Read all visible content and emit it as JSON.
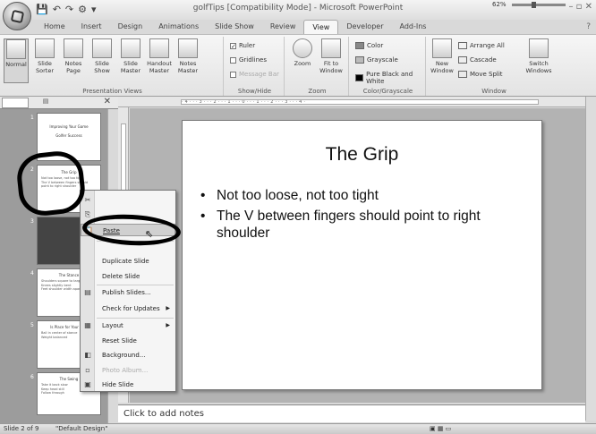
{
  "window": {
    "title": "golfTips [Compatibility Mode] - Microsoft PowerPoint",
    "controls": "– ▫ ✕"
  },
  "qat": [
    "💾",
    "↶",
    "↷",
    "⚙",
    "▾"
  ],
  "tabs": [
    "Home",
    "Insert",
    "Design",
    "Animations",
    "Slide Show",
    "Review",
    "View",
    "Developer",
    "Add-Ins"
  ],
  "active_tab": "View",
  "ribbon": {
    "presentation_views": {
      "label": "Presentation Views",
      "buttons": [
        "Normal",
        "Slide Sorter",
        "Notes Page",
        "Slide Show",
        "Slide Master",
        "Handout Master",
        "Notes Master"
      ]
    },
    "show_hide": {
      "label": "Show/Hide",
      "items": [
        {
          "label": "Ruler",
          "checked": true,
          "enabled": true
        },
        {
          "label": "Gridlines",
          "checked": false,
          "enabled": true
        },
        {
          "label": "Message Bar",
          "checked": false,
          "enabled": false
        }
      ]
    },
    "zoom": {
      "label": "Zoom",
      "buttons": [
        "Zoom",
        "Fit to Window"
      ]
    },
    "color": {
      "label": "Color/Grayscale",
      "buttons": [
        "Color",
        "Grayscale",
        "Pure Black and White"
      ]
    },
    "window_group": {
      "label": "Window",
      "new_window": "New Window",
      "arrange_all": "Arrange All",
      "cascade": "Cascade",
      "move_split": "Move Split",
      "switch_windows": "Switch Windows"
    }
  },
  "ruler_ticks": "·4···3···2···1···0···1···2···3···4·",
  "slides": [
    {
      "num": "1",
      "title": "Improving Your Game",
      "lines": [
        "Golfer Success"
      ]
    },
    {
      "num": "2",
      "title": "The Grip",
      "lines": [
        "Not too loose, not too tight",
        "The V between fingers should point to right shoulder"
      ]
    },
    {
      "num": "3",
      "title": "",
      "lines": []
    },
    {
      "num": "4",
      "title": "The Stance",
      "lines": [
        "Shoulders square to target",
        "Knees slightly bent",
        "Feet shoulder width apart"
      ]
    },
    {
      "num": "5",
      "title": "Is Place for Your Feet",
      "lines": [
        "Ball in center of stance",
        "Weight balanced"
      ]
    },
    {
      "num": "6",
      "title": "The Swing",
      "lines": [
        "Take it back slow",
        "Keep head still",
        "Follow through"
      ]
    }
  ],
  "current_slide": {
    "title": "The Grip",
    "bullets": [
      "Not too loose, not too tight",
      "The V between fingers should point to right shoulder"
    ]
  },
  "notes_placeholder": "Click to add notes",
  "status": {
    "slide": "Slide 2 of 9",
    "theme": "\"Default Design\"",
    "zoom": "62%"
  },
  "context_menu": [
    {
      "label": "Cut",
      "icon": "✂",
      "hover": false,
      "enabled": true
    },
    {
      "label": "Copy",
      "icon": "⎘",
      "hover": false,
      "enabled": true
    },
    {
      "label": "Paste",
      "icon": "📋",
      "hover": true,
      "enabled": true
    },
    {
      "label": "Duplicate Slide",
      "icon": "",
      "hover": false,
      "enabled": true
    },
    {
      "label": "Delete Slide",
      "icon": "",
      "hover": false,
      "enabled": true
    },
    {
      "label": "Publish Slides...",
      "icon": "▤",
      "hover": false,
      "enabled": true
    },
    {
      "label": "Check for Updates",
      "icon": "",
      "hover": false,
      "enabled": true,
      "submenu": true
    },
    {
      "label": "Layout",
      "icon": "▦",
      "hover": false,
      "enabled": true,
      "submenu": true
    },
    {
      "label": "Reset Slide",
      "icon": "",
      "hover": false,
      "enabled": true
    },
    {
      "label": "Background...",
      "icon": "◧",
      "hover": false,
      "enabled": true
    },
    {
      "label": "Photo Album...",
      "icon": "▫",
      "hover": false,
      "enabled": false
    },
    {
      "label": "Hide Slide",
      "icon": "▣",
      "hover": false,
      "enabled": true
    }
  ]
}
